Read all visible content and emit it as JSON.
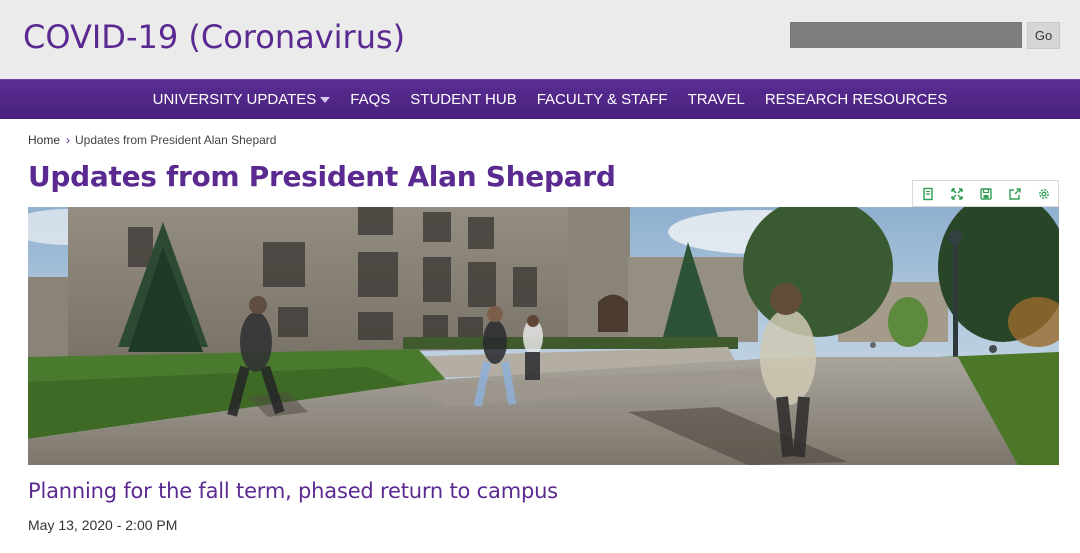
{
  "header": {
    "site_title": "COVID-19 (Coronavirus)",
    "search_placeholder": "",
    "go_label": "Go"
  },
  "nav": {
    "items": [
      {
        "label": "UNIVERSITY UPDATES",
        "has_dropdown": true
      },
      {
        "label": "FAQS"
      },
      {
        "label": "STUDENT HUB"
      },
      {
        "label": "FACULTY & STAFF"
      },
      {
        "label": "TRAVEL"
      },
      {
        "label": "RESEARCH RESOURCES"
      }
    ]
  },
  "breadcrumb": {
    "home": "Home",
    "separator": "›",
    "current": "Updates from President Alan Shepard"
  },
  "page": {
    "title": "Updates from President Alan Shepard"
  },
  "tools": [
    {
      "icon": "book-icon"
    },
    {
      "icon": "expand-icon"
    },
    {
      "icon": "save-icon"
    },
    {
      "icon": "share-icon"
    },
    {
      "icon": "settings-icon"
    }
  ],
  "hero": {
    "description_icon": "campus-photo"
  },
  "article": {
    "title": "Planning for the fall term, phased return to campus",
    "date": "May 13, 2020 - 2:00 PM"
  },
  "colors": {
    "brand_purple": "#5b2a91",
    "nav_purple": "#4e2a84",
    "tool_green": "#2f9e54",
    "header_bg": "#ebebeb"
  }
}
